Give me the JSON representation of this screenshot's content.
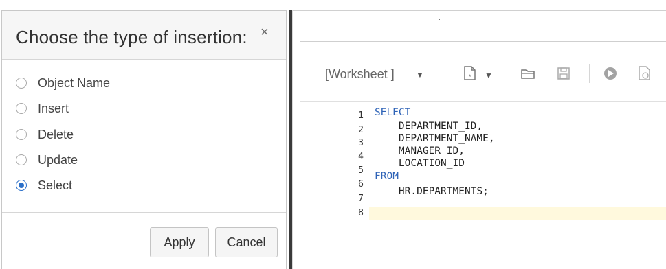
{
  "dialog": {
    "title": "Choose the type of insertion:",
    "close_glyph": "×",
    "options": [
      {
        "label": "Object Name",
        "selected": false
      },
      {
        "label": "Insert",
        "selected": false
      },
      {
        "label": "Delete",
        "selected": false
      },
      {
        "label": "Update",
        "selected": false
      },
      {
        "label": "Select",
        "selected": true
      }
    ],
    "apply_label": "Apply",
    "cancel_label": "Cancel"
  },
  "worksheet": {
    "selector_label": "[Worksheet ]",
    "icons": [
      "new-file-icon",
      "open-folder-icon",
      "save-icon",
      "run-icon",
      "run-script-icon"
    ],
    "accent_color": "#2e63b7",
    "lines": [
      {
        "num": "1",
        "text": "SELECT"
      },
      {
        "num": "2",
        "text": "    DEPARTMENT_ID,"
      },
      {
        "num": "3",
        "text": "    DEPARTMENT_NAME,"
      },
      {
        "num": "4",
        "text": "    MANAGER_ID,"
      },
      {
        "num": "5",
        "text": "    LOCATION_ID"
      },
      {
        "num": "6",
        "text": "FROM"
      },
      {
        "num": "7",
        "text": "    HR.DEPARTMENTS;"
      },
      {
        "num": "8",
        "text": ""
      }
    ]
  }
}
